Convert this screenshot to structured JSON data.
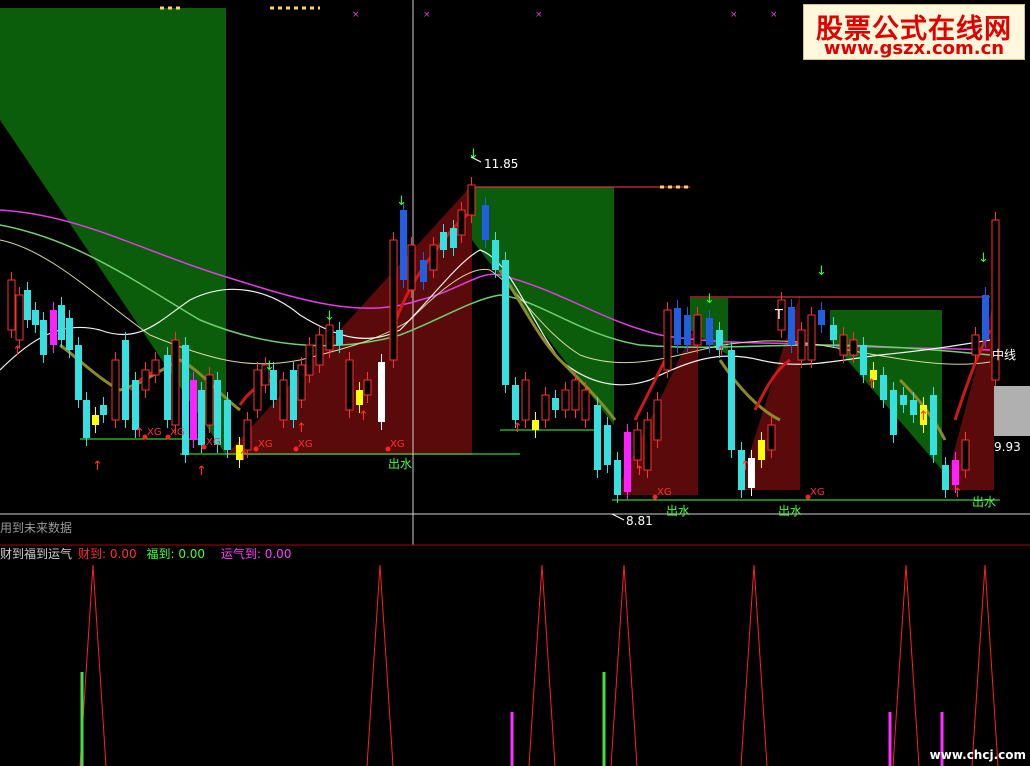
{
  "watermark": {
    "title": "股票公式在线网",
    "url": "www.gszx.com.cn"
  },
  "main_chart": {
    "price_high_label": "11.85",
    "price_low_label": "8.81",
    "right_price_label": "9.93",
    "mid_line_label": "中线",
    "signal_xg": "XG",
    "signal_out": "出水",
    "signal_t": "T",
    "note": "用到未来数据"
  },
  "sub_chart": {
    "name": "财到福到运气",
    "caidao_label": "财到",
    "caidao_value": "0.00",
    "fudao_label": "福到",
    "fudao_value": "0.00",
    "yunqi_label": "运气到",
    "yunqi_value": "0.00"
  },
  "footer": {
    "site": "www.chcj.com"
  },
  "colors": {
    "bg": "#000000",
    "up": "#ff3030",
    "down": "#36e0e0",
    "red_zone": "#5a0a0a",
    "green_zone": "#0b5c0b",
    "blue_candle": "#1f5fe0",
    "magenta": "#ff20ff",
    "yellow": "#ffff00",
    "white": "#ffffff",
    "grid": "#555555"
  }
}
